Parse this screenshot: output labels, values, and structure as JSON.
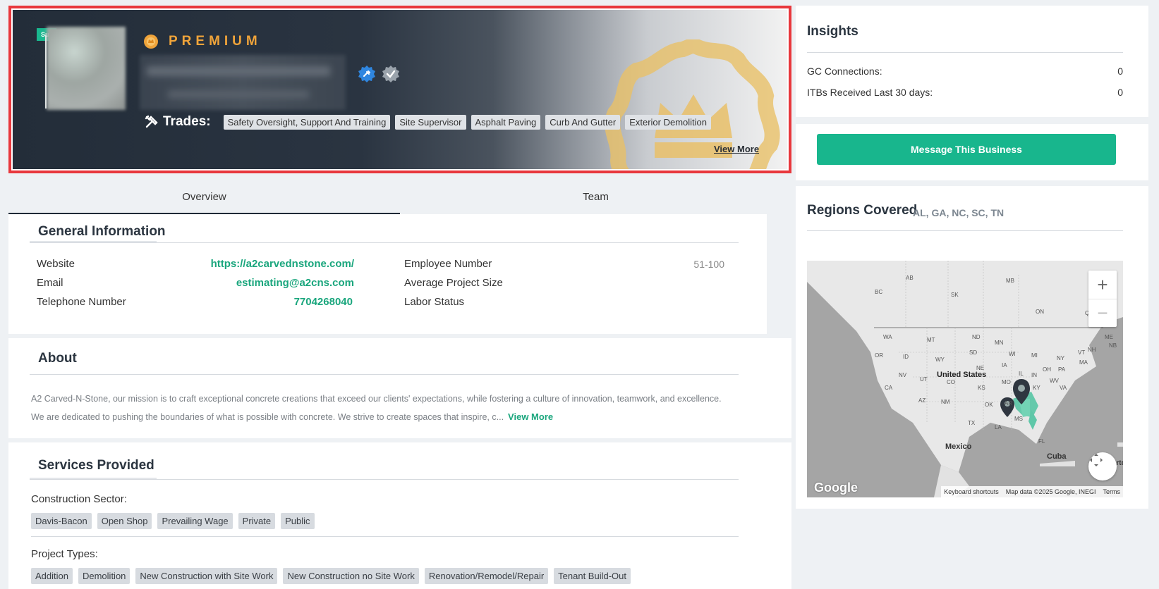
{
  "hero": {
    "sub_tag": "Su",
    "premium_label": "PREMIUM",
    "trades_label": "Trades:",
    "trades": [
      "Safety Oversight, Support And Training",
      "Site Supervisor",
      "Asphalt Paving",
      "Curb And Gutter",
      "Exterior Demolition"
    ],
    "view_more": "View More"
  },
  "tabs": [
    {
      "label": "Overview",
      "active": true
    },
    {
      "label": "Team",
      "active": false
    }
  ],
  "general": {
    "title": "General Information",
    "website_label": "Website",
    "website_value": "https://a2carvednstone.com/",
    "email_label": "Email",
    "email_value": "estimating@a2cns.com",
    "phone_label": "Telephone Number",
    "phone_value": "7704268040",
    "employee_label": "Employee Number",
    "employee_value": "51-100",
    "project_size_label": "Average Project Size",
    "labor_label": "Labor Status"
  },
  "about": {
    "title": "About",
    "text_line1": "A2 Carved-N-Stone, our mission is to craft exceptional concrete creations that exceed our clients' expectations, while fostering a culture of innovation, teamwork, and excellence.",
    "text_line2": "We are dedicated to pushing the boundaries of what is possible with concrete. We strive to create spaces that inspire, c...",
    "view_more": "View More"
  },
  "services": {
    "title": "Services Provided",
    "sector_label": "Construction Sector:",
    "sectors": [
      "Davis-Bacon",
      "Open Shop",
      "Prevailing Wage",
      "Private",
      "Public"
    ],
    "project_types_label": "Project Types:",
    "project_types": [
      "Addition",
      "Demolition",
      "New Construction with Site Work",
      "New Construction no Site Work",
      "Renovation/Remodel/Repair",
      "Tenant Build-Out"
    ]
  },
  "insights": {
    "title": "Insights",
    "gc_label": "GC Connections:",
    "gc_value": "0",
    "itb_label": "ITBs Received Last 30 days:",
    "itb_value": "0"
  },
  "message_button": "Message This Business",
  "regions": {
    "title": "Regions Covered",
    "states": "AL, GA, NC, SC, TN",
    "map": {
      "labels": [
        "AB",
        "MB",
        "BC",
        "SK",
        "ON",
        "QC",
        "WA",
        "MT",
        "ND",
        "MN",
        "OR",
        "ID",
        "WY",
        "SD",
        "WI",
        "MI",
        "NV",
        "UT",
        "CO",
        "NE",
        "IA",
        "IL",
        "IN",
        "OH",
        "PA",
        "NY",
        "CA",
        "AZ",
        "NM",
        "KS",
        "MO",
        "KY",
        "WV",
        "VA",
        "OK",
        "AR",
        "TX",
        "LA",
        "MS",
        "FL",
        "ME",
        "VT",
        "NH",
        "MA",
        "NB"
      ],
      "country_us": "United States",
      "country_mx": "Mexico",
      "country_cu": "Cuba",
      "country_pr": "Puerto Ric",
      "google": "Google",
      "footer_shortcuts": "Keyboard shortcuts",
      "footer_data": "Map data ©2025 Google, INEGI",
      "footer_terms": "Terms",
      "zoom_in": "+",
      "zoom_out": "−"
    }
  }
}
